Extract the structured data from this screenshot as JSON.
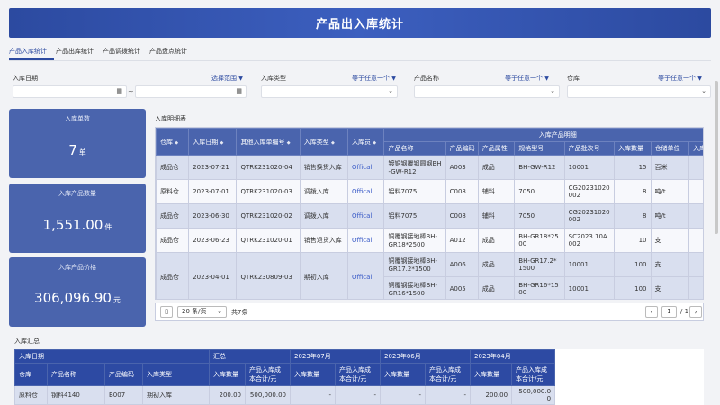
{
  "title": "产品出入库统计",
  "tabs": [
    "产品入库统计",
    "产品出库统计",
    "产品调拨统计",
    "产品盘点统计"
  ],
  "filters": {
    "date_label": "入库日期",
    "date_link": "选择范围",
    "type_label": "入库类型",
    "type_link": "等于任意一个",
    "name_label": "产品名称",
    "name_link": "等于任意一个",
    "warehouse_label": "仓库",
    "warehouse_link": "等于任意一个"
  },
  "cards": [
    {
      "title": "入库单数",
      "value": "7",
      "unit": "单"
    },
    {
      "title": "入库产品数量",
      "value": "1,551.00",
      "unit": "件"
    },
    {
      "title": "入库产品价格",
      "value": "306,096.90",
      "unit": "元"
    }
  ],
  "detail": {
    "title": "入库明细表",
    "group_header": "入库产品明细",
    "headers": [
      "仓库",
      "入库日期",
      "其他入库单编号",
      "入库类型",
      "入库员",
      "产品名称",
      "产品编码",
      "产品属性",
      "规格型号",
      "产品批次号",
      "入库数量",
      "仓储单位",
      "入库产品总价"
    ],
    "rows": [
      {
        "wh": "成品仓",
        "date": "2023-07-21",
        "no": "QTRK231020-04",
        "type": "销售换货入库",
        "staff": "Offical",
        "items": [
          {
            "name": "镀铜钢覆钢圆钢BH-GW-R12",
            "code": "A003",
            "attr": "成品",
            "spec": "BH-GW-R12",
            "batch": "10001",
            "qty": "15",
            "unit": "百米",
            "price": "5,91"
          }
        ]
      },
      {
        "wh": "原料仓",
        "date": "2023-07-01",
        "no": "QTRK231020-03",
        "type": "调拨入库",
        "staff": "Offical",
        "items": [
          {
            "name": "铝料7075",
            "code": "C008",
            "attr": "辅料",
            "spec": "7050",
            "batch": "CG20231020002",
            "qty": "8",
            "unit": "吨/t",
            "price": ""
          }
        ]
      },
      {
        "wh": "成品仓",
        "date": "2023-06-30",
        "no": "QTRK231020-02",
        "type": "调拨入库",
        "staff": "Offical",
        "items": [
          {
            "name": "铝料7075",
            "code": "C008",
            "attr": "辅料",
            "spec": "7050",
            "batch": "CG20231020002",
            "qty": "8",
            "unit": "吨/t",
            "price": ""
          }
        ]
      },
      {
        "wh": "成品仓",
        "date": "2023-06-23",
        "no": "QTRK231020-01",
        "type": "销售退货入库",
        "staff": "Offical",
        "items": [
          {
            "name": "铜覆钢接地棒BH-GR18*2500",
            "code": "A012",
            "attr": "成品",
            "spec": "BH-GR18*2500",
            "batch": "SC2023.10A002",
            "qty": "10",
            "unit": "支",
            "price": "1,98"
          }
        ]
      },
      {
        "wh": "成品仓",
        "date": "2023-04-01",
        "no": "QTRK230809-03",
        "type": "期初入库",
        "staff": "Offical",
        "items": [
          {
            "name": "铜覆钢接地棒BH-GR17.2*1500",
            "code": "A006",
            "attr": "成品",
            "spec": "BH-GR17.2*1500",
            "batch": "10001",
            "qty": "100",
            "unit": "支",
            "price": "11,20"
          },
          {
            "name": "铜覆钢接地棒BH-GR16*1500",
            "code": "A005",
            "attr": "成品",
            "spec": "BH-GR16*1500",
            "batch": "10001",
            "qty": "100",
            "unit": "支",
            "price": "10,90"
          }
        ]
      }
    ]
  },
  "pager": {
    "page_size": "20 条/页",
    "total": "共7条",
    "page": "1",
    "of": "/ 1"
  },
  "summary": {
    "title": "入库汇总",
    "top_headers": [
      "入库日期",
      "汇总",
      "2023年07月",
      "2023年06月",
      "2023年04月"
    ],
    "sub_headers": [
      "仓库",
      "产品名称",
      "产品编码",
      "入库类型",
      "入库数量",
      "产品入库成本合计/元",
      "入库数量",
      "产品入库成本合计/元",
      "入库数量",
      "产品入库成本合计/元",
      "入库数量",
      "产品入库成本合计/元"
    ],
    "rows": [
      [
        "原料仓",
        "钢料4140",
        "B007",
        "期初入库",
        "200.00",
        "500,000.00",
        "-",
        "-",
        "-",
        "-",
        "200.00",
        "500,000.00"
      ]
    ]
  }
}
